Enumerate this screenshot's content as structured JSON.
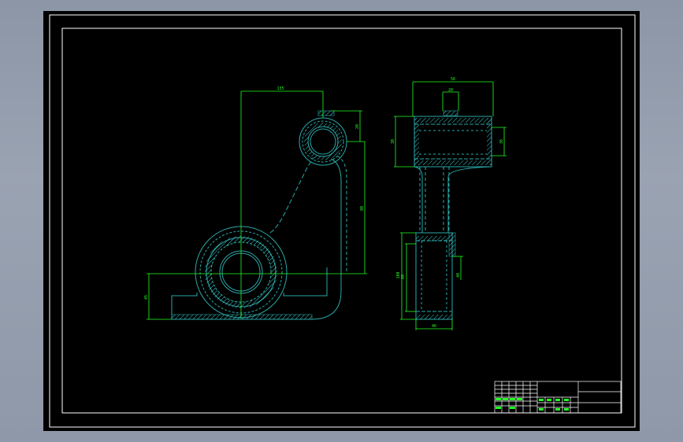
{
  "colors": {
    "background": "#000000",
    "border": "#ffffff",
    "outline": "#2aa8a8",
    "dimension": "#22ff22",
    "hatch": "#3fd0d0",
    "window": "#9aa3b2"
  },
  "front_view": {
    "dim_top": "135",
    "dim_boss_height": "20",
    "dim_vertical": "80",
    "dim_left_height": "45"
  },
  "side_view": {
    "dim_top_width": "56",
    "dim_top_inner": "20",
    "dim_left_height": "30",
    "dim_right_height": "36",
    "dim_left_lower": "100",
    "dim_inner_lower": "80",
    "dim_right_lower": "40",
    "dim_bottom_width": "46"
  },
  "title_block": {
    "labels": [
      "",
      "",
      "",
      "",
      "",
      ""
    ]
  }
}
